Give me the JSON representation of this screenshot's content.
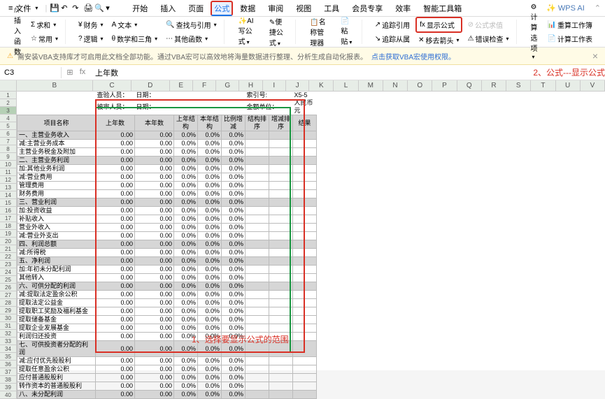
{
  "menubar": {
    "file": "文件",
    "items": [
      "开始",
      "插入",
      "页面",
      "公式",
      "数据",
      "审阅",
      "视图",
      "工具",
      "会员专享",
      "效率",
      "智能工具箱"
    ],
    "active_index": 3,
    "wps_ai": "WPS AI"
  },
  "ribbon": {
    "fx": "fx",
    "insert_fn": "插入函数",
    "sum": "求和",
    "common": "常用",
    "finance": "财务",
    "text": "文本",
    "lookup": "查找与引用",
    "logic": "逻辑",
    "math": "数学和三角",
    "more_fn": "其他函数",
    "ai_write": "AI 写公式",
    "convenient": "便捷公式",
    "name_mgr": "名称管理器",
    "paste": "粘贴",
    "trace_precedent": "追踪引用",
    "show_formula": "显示公式",
    "formula_eval": "公式求值",
    "trace_dependent": "追踪从属",
    "remove_arrows": "移去箭头",
    "error_check": "错误检查",
    "calc_options": "计算选项",
    "recalc_wb": "重算工作簿",
    "calc_sheet": "计算工作表"
  },
  "notice": {
    "text": "需安装VBA支持库才可启用此文档全部功能。通过VBA宏可以高效地将海量数据进行整理、分析生成自动化报表。",
    "link": "点击获取VBA宏使用权限。"
  },
  "formula_bar": {
    "name": "C3",
    "fx": "fx",
    "content": "上年数"
  },
  "callouts": {
    "c1": "1、选择要显示公式的范围",
    "c2": "2、公式---显示公式"
  },
  "meta": {
    "r1a": "查验人员：",
    "r1b": "日期：",
    "r1c": "索引号:",
    "r1d": "X5-5",
    "r2a": "被审人员：",
    "r2b": "日期：",
    "r2c": "金额单位：",
    "r2d": "人民币元"
  },
  "cols": [
    "",
    "B",
    "C",
    "D",
    "E",
    "F",
    "G",
    "H",
    "I",
    "J",
    "K",
    "L",
    "M",
    "N",
    "O",
    "P",
    "Q",
    "R",
    "S",
    "T",
    "U",
    "V"
  ],
  "headers": {
    "name": "项目名称",
    "c": "上年数",
    "d": "本年数",
    "e": "上年结构",
    "f": "本年结构",
    "g": "比例增减",
    "h": "结构排序",
    "i": "增减排序",
    "j": "结果"
  },
  "rows": [
    {
      "n": 5,
      "label": "一、主营业务收入",
      "shade": true
    },
    {
      "n": 6,
      "label": "减:主营业务成本"
    },
    {
      "n": 7,
      "label": "主营业务税金及附加"
    },
    {
      "n": 8,
      "label": "二、主营业务利润",
      "shade": true
    },
    {
      "n": 9,
      "label": "加:其他业务利润"
    },
    {
      "n": 10,
      "label": "减:营业费用"
    },
    {
      "n": 11,
      "label": "管理费用"
    },
    {
      "n": 12,
      "label": "财务费用"
    },
    {
      "n": 13,
      "label": "三、营业利润",
      "shade": true
    },
    {
      "n": 14,
      "label": "加:投资收益"
    },
    {
      "n": 15,
      "label": "补贴收入"
    },
    {
      "n": 16,
      "label": "营业外收入"
    },
    {
      "n": 17,
      "label": "减:营业外支出"
    },
    {
      "n": 18,
      "label": "四、利润总额",
      "shade": true
    },
    {
      "n": 19,
      "label": "减:所得税"
    },
    {
      "n": 20,
      "label": "五、净利润",
      "shade": true
    },
    {
      "n": 21,
      "label": "加:年初未分配利润"
    },
    {
      "n": 22,
      "label": "其他转入"
    },
    {
      "n": 23,
      "label": "六、可供分配的利润",
      "shade": true
    },
    {
      "n": 24,
      "label": "减:提取法定盈余公积"
    },
    {
      "n": 25,
      "label": "提取法定公益金"
    },
    {
      "n": 26,
      "label": "提取职工奖励及福利基金"
    },
    {
      "n": 27,
      "label": "提取储备基金"
    },
    {
      "n": 28,
      "label": "提取企业发展基金"
    },
    {
      "n": 29,
      "label": "利润归还投资"
    },
    {
      "n": 30,
      "label": "七、可供投资者分配的利润",
      "shade": true
    },
    {
      "n": 31,
      "label": "减:应付优先股股利"
    },
    {
      "n": 32,
      "label": "提取任意盈余公积"
    },
    {
      "n": 33,
      "label": "应付普通股股利"
    },
    {
      "n": 34,
      "label": "转作资本的普通股股利"
    },
    {
      "n": 35,
      "label": "八、未分配利润",
      "shade": true
    }
  ],
  "cell_values": {
    "c": "0.00",
    "d": "0.00",
    "e": "0.0%",
    "f": "0.0%",
    "g": "0.0%"
  }
}
